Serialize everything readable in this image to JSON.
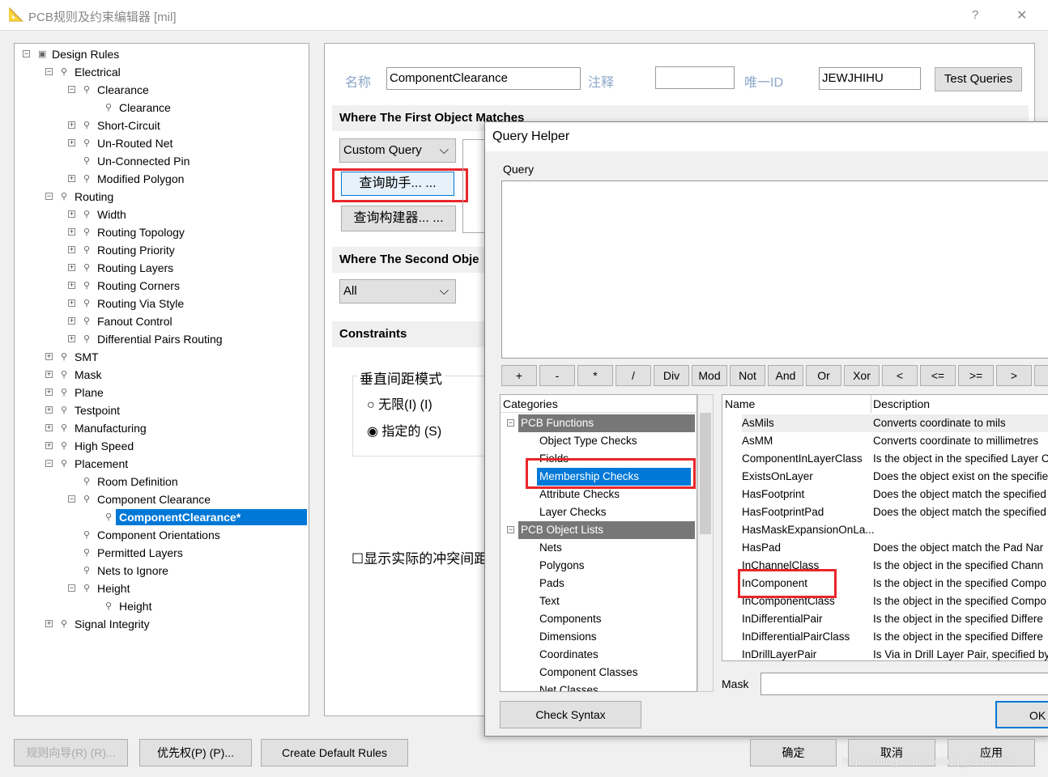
{
  "window": {
    "title": "PCB规则及约束编辑器 [mil]",
    "help": "?",
    "close": "✕"
  },
  "tree": [
    {
      "label": "Design Rules",
      "level": 0,
      "exp": "-"
    },
    {
      "label": "Electrical",
      "level": 1,
      "exp": "-"
    },
    {
      "label": "Clearance",
      "level": 2,
      "exp": "-"
    },
    {
      "label": "Clearance",
      "level": 3,
      "exp": ""
    },
    {
      "label": "Short-Circuit",
      "level": 2,
      "exp": "+"
    },
    {
      "label": "Un-Routed Net",
      "level": 2,
      "exp": "+"
    },
    {
      "label": "Un-Connected Pin",
      "level": 2,
      "exp": ""
    },
    {
      "label": "Modified Polygon",
      "level": 2,
      "exp": "+"
    },
    {
      "label": "Routing",
      "level": 1,
      "exp": "-"
    },
    {
      "label": "Width",
      "level": 2,
      "exp": "+"
    },
    {
      "label": "Routing Topology",
      "level": 2,
      "exp": "+"
    },
    {
      "label": "Routing Priority",
      "level": 2,
      "exp": "+"
    },
    {
      "label": "Routing Layers",
      "level": 2,
      "exp": "+"
    },
    {
      "label": "Routing Corners",
      "level": 2,
      "exp": "+"
    },
    {
      "label": "Routing Via Style",
      "level": 2,
      "exp": "+"
    },
    {
      "label": "Fanout Control",
      "level": 2,
      "exp": "+"
    },
    {
      "label": "Differential Pairs Routing",
      "level": 2,
      "exp": "+"
    },
    {
      "label": "SMT",
      "level": 1,
      "exp": "+"
    },
    {
      "label": "Mask",
      "level": 1,
      "exp": "+"
    },
    {
      "label": "Plane",
      "level": 1,
      "exp": "+"
    },
    {
      "label": "Testpoint",
      "level": 1,
      "exp": "+"
    },
    {
      "label": "Manufacturing",
      "level": 1,
      "exp": "+"
    },
    {
      "label": "High Speed",
      "level": 1,
      "exp": "+"
    },
    {
      "label": "Placement",
      "level": 1,
      "exp": "-"
    },
    {
      "label": "Room Definition",
      "level": 2,
      "exp": ""
    },
    {
      "label": "Component Clearance",
      "level": 2,
      "exp": "-"
    },
    {
      "label": "ComponentClearance*",
      "level": 3,
      "exp": "",
      "selected": true
    },
    {
      "label": "Component Orientations",
      "level": 2,
      "exp": ""
    },
    {
      "label": "Permitted Layers",
      "level": 2,
      "exp": ""
    },
    {
      "label": "Nets to Ignore",
      "level": 2,
      "exp": ""
    },
    {
      "label": "Height",
      "level": 2,
      "exp": "-"
    },
    {
      "label": "Height",
      "level": 3,
      "exp": ""
    },
    {
      "label": "Signal Integrity",
      "level": 1,
      "exp": "+"
    }
  ],
  "rule": {
    "name_label": "名称",
    "name_value": "ComponentClearance",
    "comment_label": "注释",
    "comment_value": "",
    "uid_label": "唯一ID",
    "uid_value": "JEWJHIHU",
    "test_queries": "Test Queries",
    "first_header": "Where The First Object Matches",
    "first_select": "Custom Query",
    "query_helper_btn": "查询助手... ...",
    "query_builder_btn": "查询构建器... ...",
    "second_header": "Where The Second Obje",
    "second_select": "All",
    "constraints_header": "Constraints",
    "vmode_label": "垂直间距模式",
    "radio_infinite": "无限(I) (I)",
    "radio_specified": "指定的 (S)",
    "show_actual": "显示实际的冲突间距"
  },
  "query_helper": {
    "title": "Query Helper",
    "query_label": "Query",
    "query_value": "",
    "operators": [
      "+",
      "-",
      "*",
      "/",
      "Div",
      "Mod",
      "Not",
      "And",
      "Or",
      "Xor",
      "<",
      "<=",
      ">=",
      ">",
      "<"
    ],
    "categories_header": "Categories",
    "categories": [
      {
        "label": "PCB Functions",
        "header": true
      },
      {
        "label": "Object Type Checks"
      },
      {
        "label": "Fields"
      },
      {
        "label": "Membership Checks",
        "selected": true
      },
      {
        "label": "Attribute Checks"
      },
      {
        "label": "Layer Checks"
      },
      {
        "label": "PCB Object Lists",
        "header": true
      },
      {
        "label": "Nets"
      },
      {
        "label": "Polygons"
      },
      {
        "label": "Pads"
      },
      {
        "label": "Text"
      },
      {
        "label": "Components"
      },
      {
        "label": "Dimensions"
      },
      {
        "label": "Coordinates"
      },
      {
        "label": "Component Classes"
      },
      {
        "label": "Net Classes"
      }
    ],
    "name_header": "Name",
    "desc_header": "Description",
    "functions": [
      {
        "name": "AsMils",
        "desc": "Converts coordinate to mils"
      },
      {
        "name": "AsMM",
        "desc": "Converts coordinate to millimetres"
      },
      {
        "name": "ComponentInLayerClass",
        "desc": "Is the object in the specified Layer C"
      },
      {
        "name": "ExistsOnLayer",
        "desc": "Does the object exist on the specifie"
      },
      {
        "name": "HasFootprint",
        "desc": "Does the object match the specified"
      },
      {
        "name": "HasFootprintPad",
        "desc": "Does the object match the specified"
      },
      {
        "name": "HasMaskExpansionOnLa...",
        "desc": ""
      },
      {
        "name": "HasPad",
        "desc": "Does the object match the Pad Nar"
      },
      {
        "name": "InChannelClass",
        "desc": "Is the object in the specified Chann"
      },
      {
        "name": "InComponent",
        "desc": "Is the object in the specified Compo"
      },
      {
        "name": "InComponentClass",
        "desc": "Is the object in the specified Compo"
      },
      {
        "name": "InDifferentialPair",
        "desc": "Is the object in the specified Differe"
      },
      {
        "name": "InDifferentialPairClass",
        "desc": "Is the object in the specified Differe"
      },
      {
        "name": "InDrillLayerPair",
        "desc": "Is Via in Drill Layer Pair, specified by"
      }
    ],
    "mask_label": "Mask",
    "mask_value": "",
    "check_syntax": "Check Syntax",
    "ok": "OK"
  },
  "bottom": {
    "rule_wizard": "规则向导(R) (R)...",
    "priorities": "优先权(P) (P)...",
    "create_default": "Create Default Rules",
    "ok": "确定",
    "cancel": "取消",
    "apply": "应用"
  },
  "watermark": "https://blog.csdn.net/qq_42392872",
  "colors": {
    "selection": "#0078d7",
    "highlight_box": "#e8262b",
    "category_header": "#777777"
  }
}
